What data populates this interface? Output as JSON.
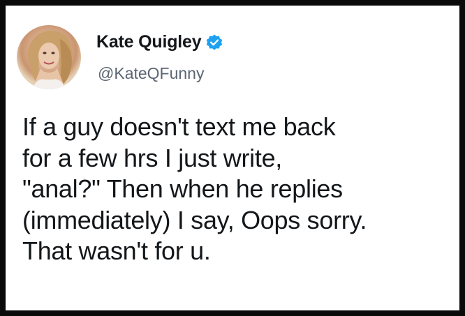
{
  "author": {
    "name": "Kate Quigley",
    "handle": "@KateQFunny",
    "verified_color": "#1da1f2"
  },
  "tweet": {
    "text": "If a guy doesn't text me back\nfor a few hrs I just write,\n\"anal?\"  Then when he replies\n(immediately) I say, Oops sorry.\nThat wasn't for u."
  },
  "colors": {
    "background": "#0a0a0a",
    "card": "#ffffff",
    "name": "#14171a",
    "handle": "#5b6672"
  }
}
